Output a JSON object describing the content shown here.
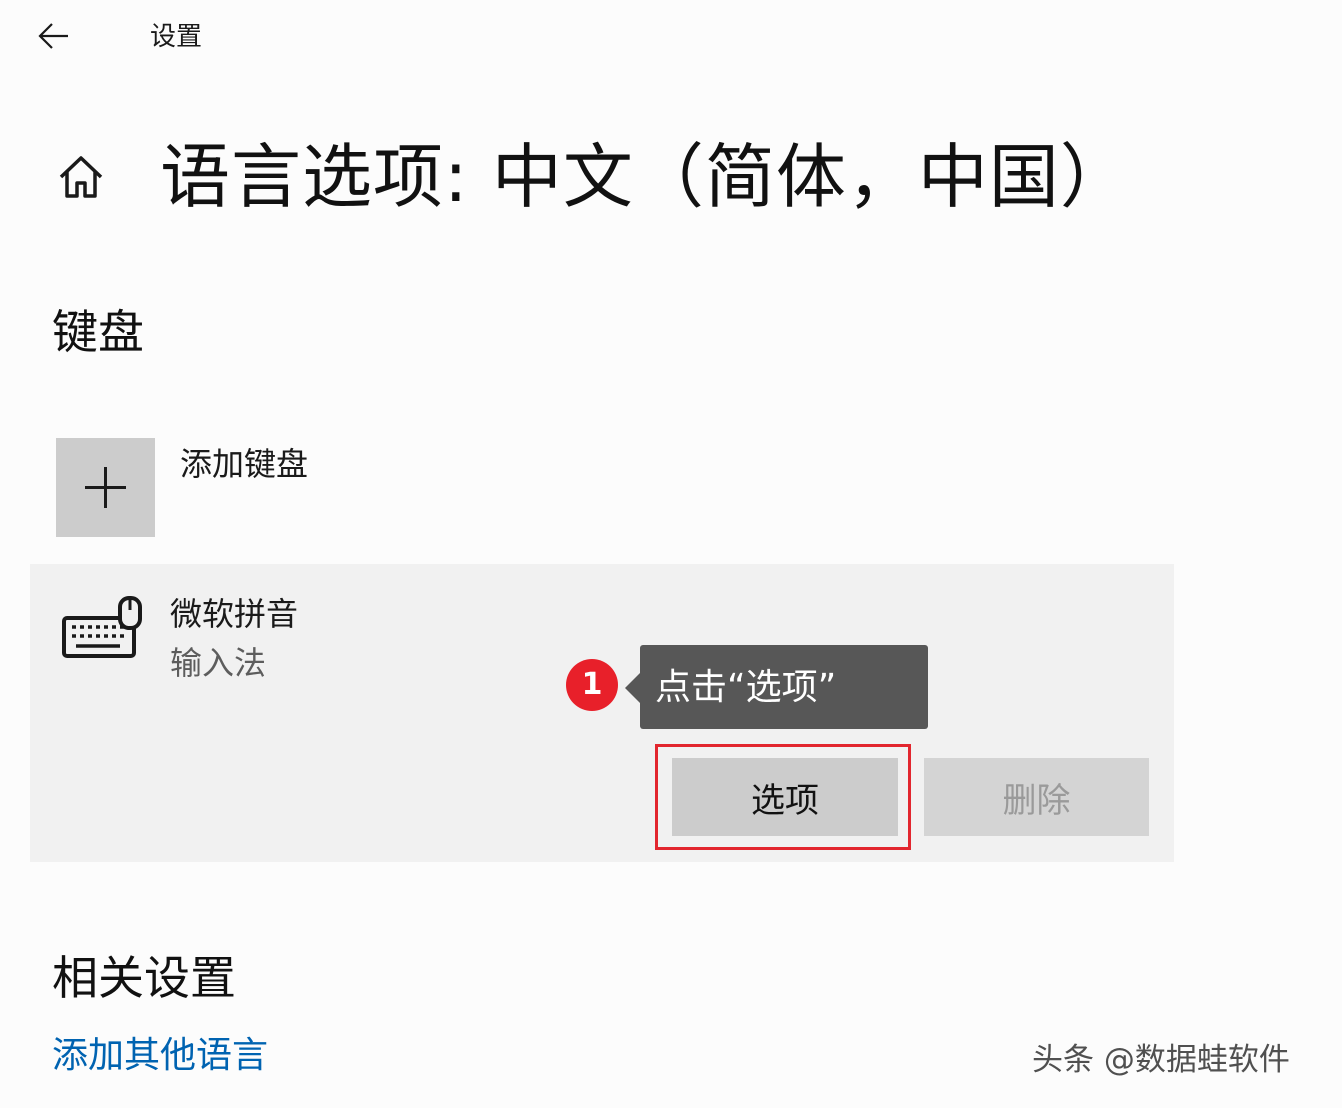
{
  "window": {
    "title": "设置"
  },
  "page": {
    "title": "语言选项: 中文（简体，中国）"
  },
  "keyboard_section": {
    "heading": "键盘",
    "add_keyboard_label": "添加键盘",
    "add_keyboard_icon": "plus-icon",
    "ime": {
      "icon": "keyboard-icon",
      "name": "微软拼音",
      "type": "输入法",
      "options_label": "选项",
      "delete_label": "删除"
    }
  },
  "annotation": {
    "step_number": "1",
    "tooltip_text": "点击“选项”",
    "badge_color": "#e8202a",
    "highlight_color": "#e2262e"
  },
  "related_section": {
    "heading": "相关设置",
    "link_label": "添加其他语言"
  },
  "watermark": "头条 @数据蛙软件",
  "colors": {
    "link": "#0063b1",
    "button_bg": "#cccccc",
    "panel_bg": "#f1f1f1"
  }
}
